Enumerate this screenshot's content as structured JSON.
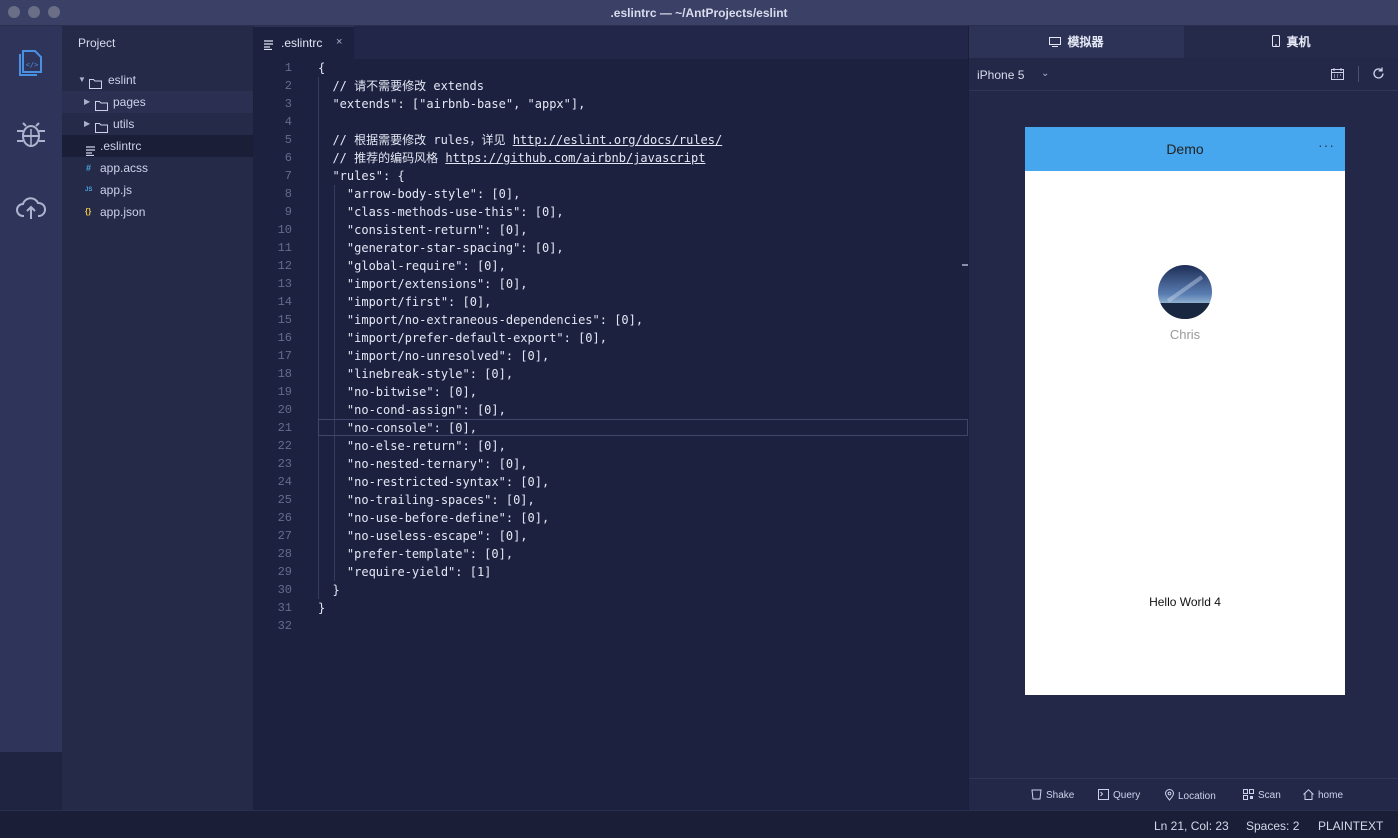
{
  "window": {
    "title": ".eslintrc — ~/AntProjects/eslint"
  },
  "activity": {
    "items": [
      {
        "icon": "code-files-icon"
      },
      {
        "icon": "debug-bug-icon"
      },
      {
        "icon": "cloud-upload-icon"
      }
    ]
  },
  "sidebar": {
    "header": "Project",
    "tree": [
      {
        "label": "eslint",
        "kind": "folder",
        "expanded": true,
        "depth": 0
      },
      {
        "label": "pages",
        "kind": "folder",
        "expanded": false,
        "depth": 1
      },
      {
        "label": "utils",
        "kind": "folder",
        "expanded": false,
        "depth": 1
      },
      {
        "label": ".eslintrc",
        "kind": "text",
        "depth": 1,
        "selected": true
      },
      {
        "label": "app.acss",
        "kind": "acss",
        "badge": "#",
        "depth": 1
      },
      {
        "label": "app.js",
        "kind": "js",
        "badge": "JS",
        "depth": 1
      },
      {
        "label": "app.json",
        "kind": "json",
        "badge": "{}",
        "depth": 1
      }
    ]
  },
  "editor": {
    "tab_label": ".eslintrc",
    "tab_close": "×",
    "lines": [
      "{",
      "  // 请不需要修改 extends",
      "  \"extends\": [\"airbnb-base\", \"appx\"],",
      "",
      "  // 根据需要修改 rules，详见 http://eslint.org/docs/rules/",
      "  // 推荐的编码风格 https://github.com/airbnb/javascript",
      "  \"rules\": {",
      "    \"arrow-body-style\": [0],",
      "    \"class-methods-use-this\": [0],",
      "    \"consistent-return\": [0],",
      "    \"generator-star-spacing\": [0],",
      "    \"global-require\": [0],",
      "    \"import/extensions\": [0],",
      "    \"import/first\": [0],",
      "    \"import/no-extraneous-dependencies\": [0],",
      "    \"import/prefer-default-export\": [0],",
      "    \"import/no-unresolved\": [0],",
      "    \"linebreak-style\": [0],",
      "    \"no-bitwise\": [0],",
      "    \"no-cond-assign\": [0],",
      "    \"no-console\": [0],",
      "    \"no-else-return\": [0],",
      "    \"no-nested-ternary\": [0],",
      "    \"no-restricted-syntax\": [0],",
      "    \"no-trailing-spaces\": [0],",
      "    \"no-use-before-define\": [0],",
      "    \"no-useless-escape\": [0],",
      "    \"prefer-template\": [0],",
      "    \"require-yield\": [1]",
      "  }",
      "}",
      ""
    ],
    "links": [
      "http://eslint.org/docs/rules/",
      "https://github.com/airbnb/javascript"
    ]
  },
  "simulator": {
    "tabs": [
      {
        "label": "模拟器",
        "icon": "monitor-icon",
        "active": true
      },
      {
        "label": "真机",
        "icon": "phone-icon",
        "active": false
      }
    ],
    "device": "iPhone 5",
    "phone": {
      "nav_title": "Demo",
      "nav_more": "···",
      "nav_color": "#47a7ee",
      "username": "Chris",
      "hello": "Hello World 4"
    },
    "actions": [
      {
        "label": "Shake",
        "icon": "shake-icon"
      },
      {
        "label": "Query",
        "icon": "query-icon"
      },
      {
        "label": "Location",
        "icon": "location-icon"
      },
      {
        "label": "Scan",
        "icon": "qr-scan-icon"
      },
      {
        "label": "home",
        "icon": "home-icon"
      }
    ]
  },
  "status": {
    "position": "Ln 21, Col: 23",
    "spaces": "Spaces: 2",
    "language": "PLAINTEXT"
  }
}
